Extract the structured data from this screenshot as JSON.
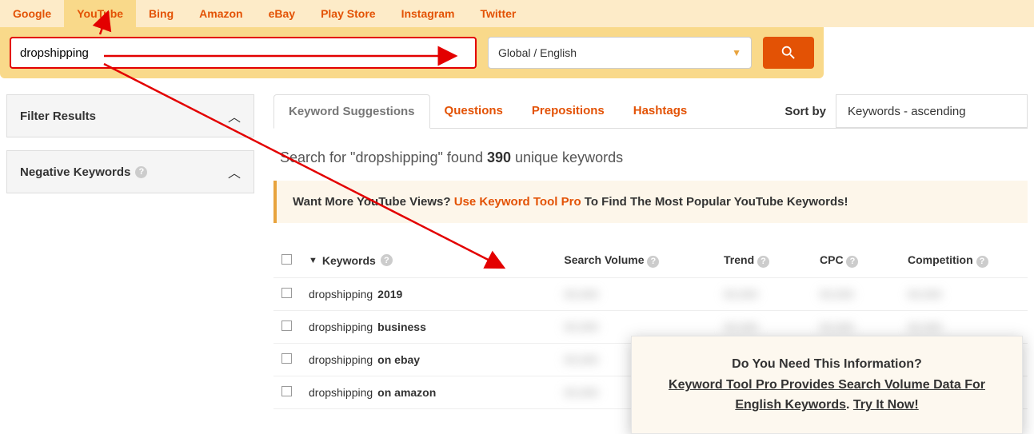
{
  "source_tabs": [
    "Google",
    "YouTube",
    "Bing",
    "Amazon",
    "eBay",
    "Play Store",
    "Instagram",
    "Twitter"
  ],
  "source_active_index": 1,
  "search": {
    "value": "dropshipping",
    "locale": "Global / English"
  },
  "filters": {
    "filter_results": "Filter Results",
    "negative_keywords": "Negative Keywords"
  },
  "result_tabs": [
    "Keyword Suggestions",
    "Questions",
    "Prepositions",
    "Hashtags"
  ],
  "result_active_index": 0,
  "sort": {
    "label": "Sort by",
    "value": "Keywords - ascending"
  },
  "summary": {
    "prefix": "Search for \"",
    "term": "dropshipping",
    "mid": "\" found ",
    "count": "390",
    "suffix": " unique keywords"
  },
  "promo": {
    "a": "Want More YouTube Views? ",
    "b": "Use Keyword Tool Pro",
    "c": " To Find The Most Popular YouTube Keywords!"
  },
  "table": {
    "headers": {
      "keywords": "Keywords",
      "search_volume": "Search Volume",
      "trend": "Trend",
      "cpc": "CPC",
      "competition": "Competition"
    },
    "rows": [
      {
        "base": "dropshipping ",
        "bold": "2019"
      },
      {
        "base": "dropshipping ",
        "bold": "business"
      },
      {
        "base": "dropshipping ",
        "bold": "on ebay"
      },
      {
        "base": "dropshipping ",
        "bold": "on amazon"
      }
    ],
    "blur_placeholder": "00,000"
  },
  "popup": {
    "line1": "Do You Need This Information?",
    "line2a": "Keyword Tool Pro Provides Search Volume Data For",
    "line2b": "English Keywords",
    "line2c": ". ",
    "line2d": "Try It Now!"
  }
}
